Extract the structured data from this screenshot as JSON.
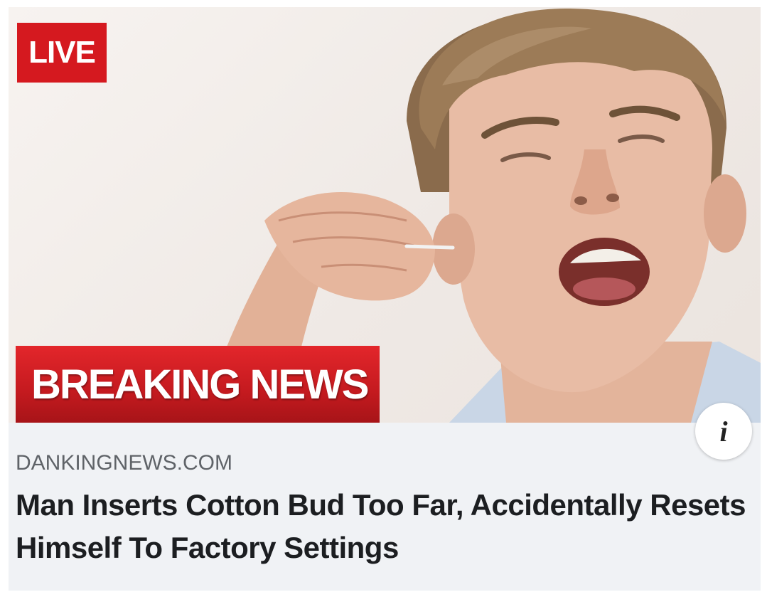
{
  "thumbnail": {
    "live_label": "LIVE",
    "banner_label": "BREAKING NEWS",
    "info_glyph": "i",
    "info_icon": "info-icon"
  },
  "link": {
    "domain": "DANKINGNEWS.COM",
    "headline": "Man Inserts Cotton Bud Too Far, Accidentally Resets Himself To Factory Settings"
  },
  "colors": {
    "live_red": "#d5191f",
    "banner_red": "#c41a1f",
    "card_bg": "#f0f2f5",
    "headline_text": "#1c1e21",
    "domain_text": "#5f6368"
  }
}
